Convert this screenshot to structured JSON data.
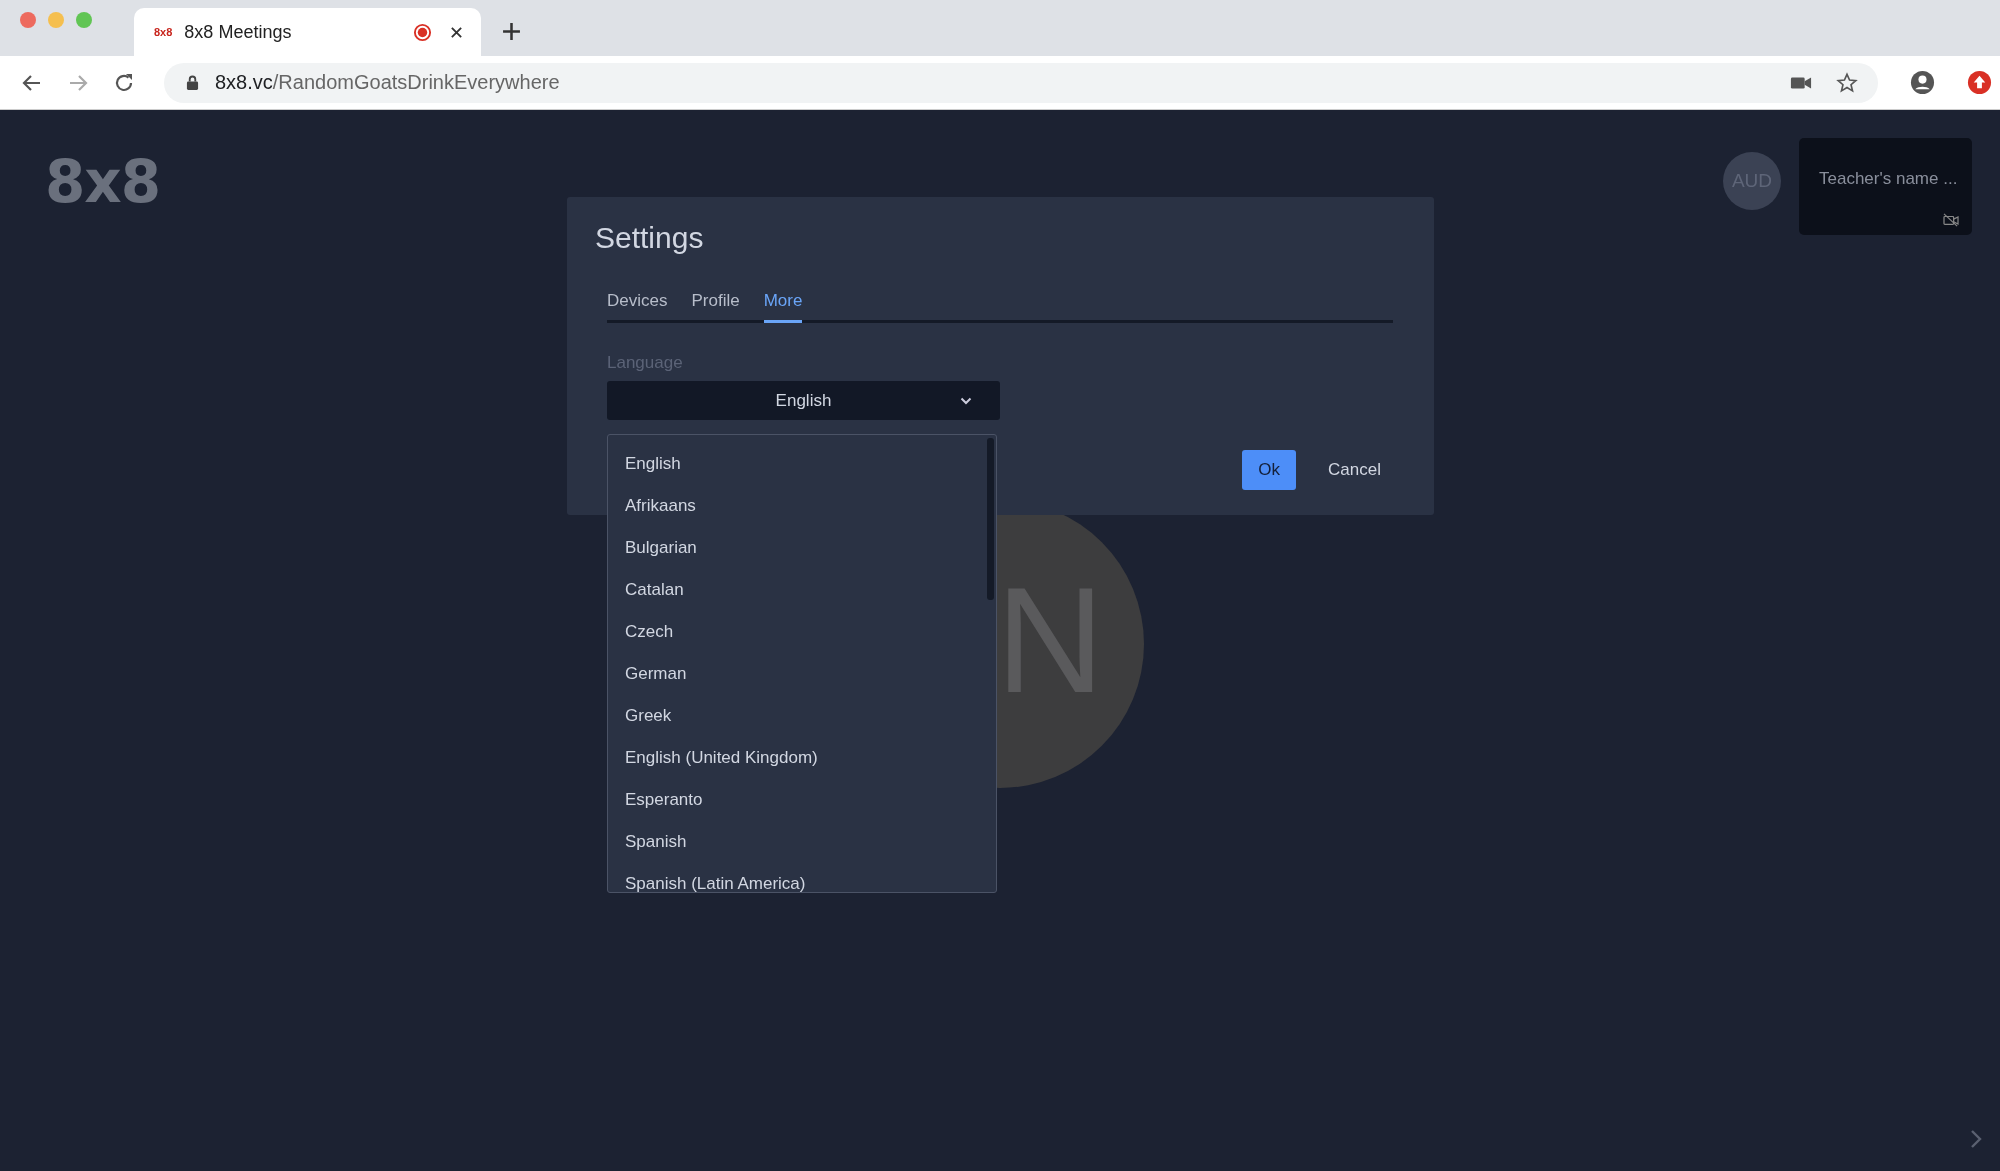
{
  "browser": {
    "tab": {
      "favicon": "8x8",
      "title": "8x8 Meetings",
      "recording": true
    },
    "address": {
      "domain": "8x8.vc",
      "path": "/RandomGoatsDrinkEverywhere"
    }
  },
  "page": {
    "logo": "8x8",
    "participants": [
      {
        "initials": "AUD"
      }
    ],
    "tile": {
      "name": "Teacher's name ...",
      "video_muted": true
    },
    "avatar": {
      "initial": "N"
    }
  },
  "dialog": {
    "title": "Settings",
    "tabs": [
      {
        "label": "Devices",
        "selected": false
      },
      {
        "label": "Profile",
        "selected": false
      },
      {
        "label": "More",
        "selected": true
      }
    ],
    "language": {
      "label": "Language",
      "value": "English",
      "expanded": true,
      "options": [
        "English",
        "Afrikaans",
        "Bulgarian",
        "Catalan",
        "Czech",
        "German",
        "Greek",
        "English (United Kingdom)",
        "Esperanto",
        "Spanish",
        "Spanish (Latin America)"
      ]
    },
    "buttons": [
      {
        "label": "Ok",
        "kind": "primary"
      },
      {
        "label": "Cancel",
        "kind": "secondary"
      }
    ]
  }
}
